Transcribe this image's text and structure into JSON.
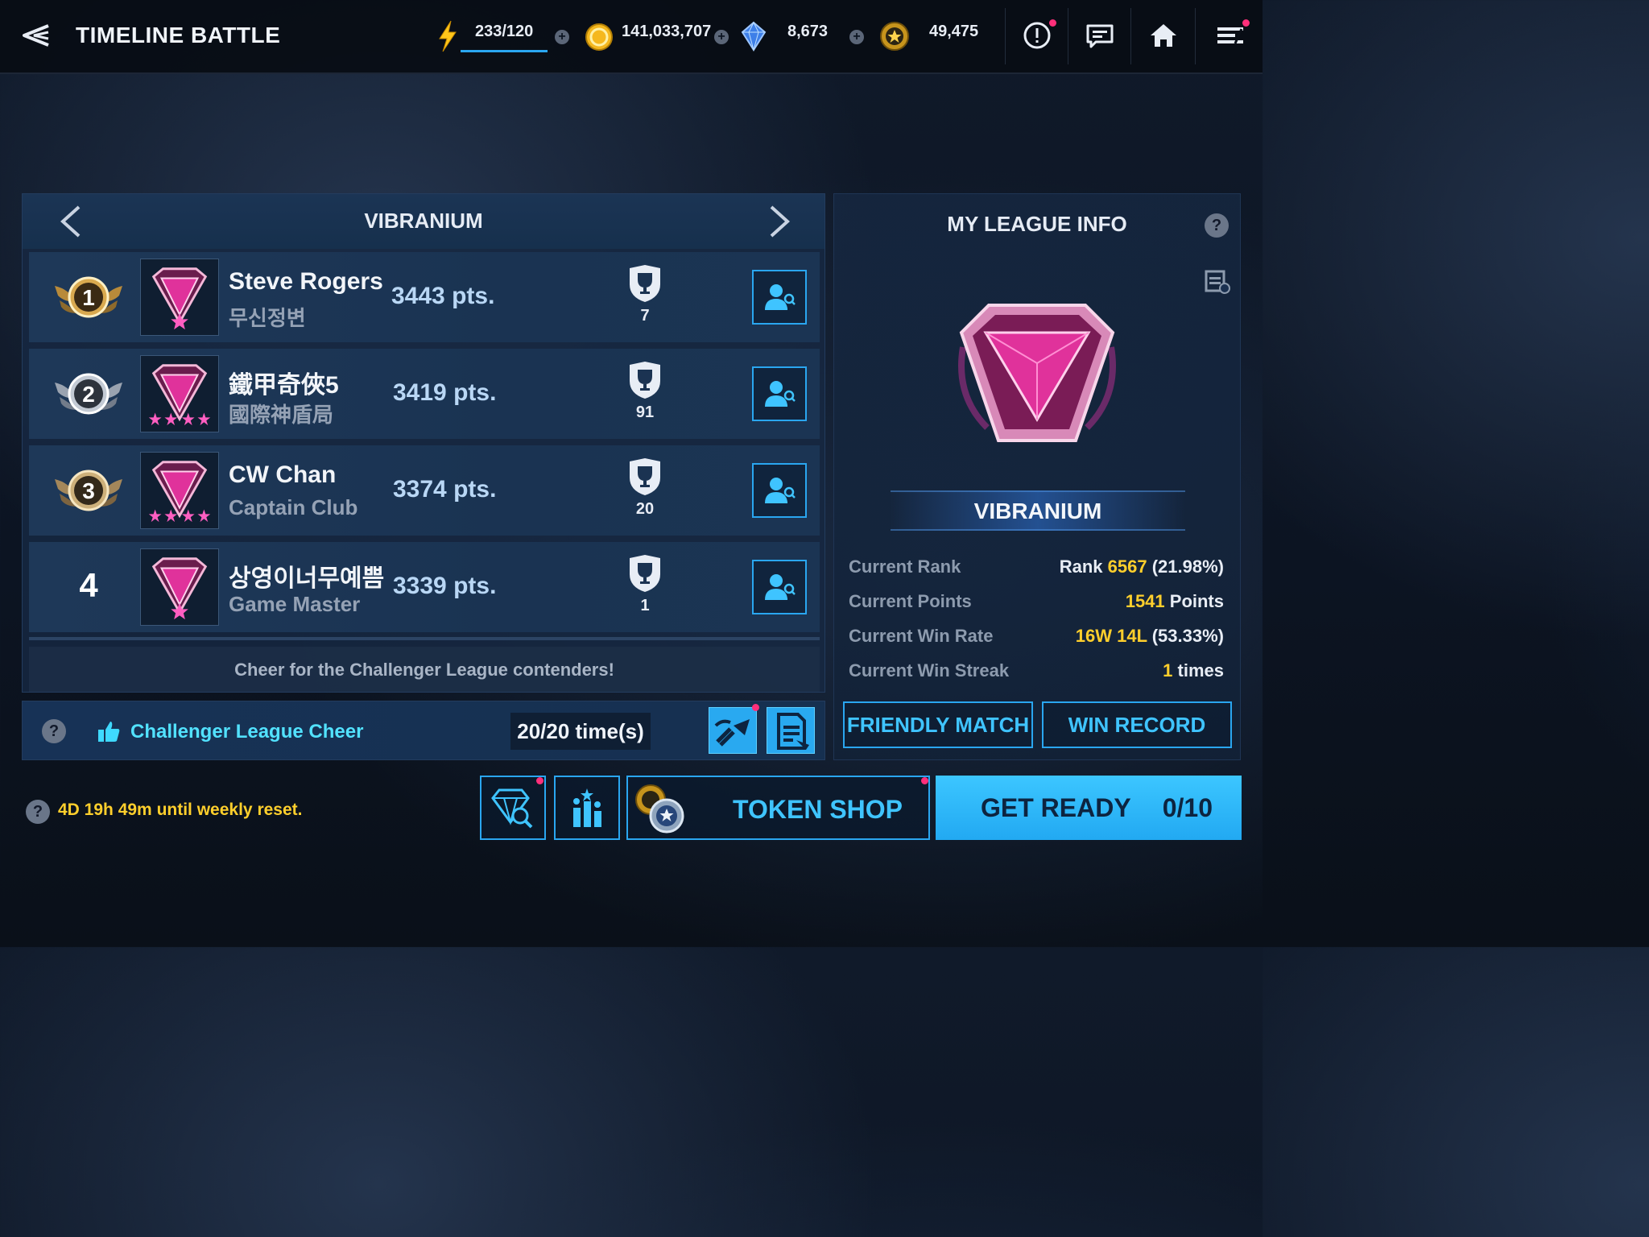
{
  "header": {
    "title": "TIMELINE BATTLE",
    "stamina": "233/120",
    "gold": "141,033,707",
    "crystals": "8,673",
    "tokens": "49,475"
  },
  "league": {
    "tier_title": "VIBRANIUM",
    "players": [
      {
        "rank": "1",
        "name": "Steve Rogers",
        "alliance": "무신정변",
        "points": "3443 pts.",
        "trophies": "7"
      },
      {
        "rank": "2",
        "name": "鐵甲奇俠5",
        "alliance": "國際神盾局",
        "points": "3419 pts.",
        "trophies": "91"
      },
      {
        "rank": "3",
        "name": "CW Chan",
        "alliance": "Captain Club",
        "points": "3374 pts.",
        "trophies": "20"
      },
      {
        "rank": "4",
        "name": "상영이너무예쁨",
        "alliance": "Game Master",
        "points": "3339 pts.",
        "trophies": "1"
      }
    ],
    "cheer_message": "Cheer for the Challenger League contenders!",
    "cheer_label": "Challenger League Cheer",
    "cheer_count": "20/20 time(s)"
  },
  "my_league": {
    "title": "MY LEAGUE INFO",
    "tier": "VIBRANIUM",
    "rank_label": "Current Rank",
    "rank_prefix": "Rank ",
    "rank_value": "6567",
    "rank_pct": " (21.98%)",
    "points_label": "Current Points",
    "points_value": "1541",
    "points_suffix": " Points",
    "winrate_label": "Current Win Rate",
    "winrate_value": "16W 14L",
    "winrate_pct": " (53.33%)",
    "streak_label": "Current Win Streak",
    "streak_value": "1",
    "streak_suffix": " times",
    "friendly_match": "FRIENDLY MATCH",
    "win_record": "WIN RECORD"
  },
  "footer": {
    "reset_time": "4D 19h 49m",
    "reset_suffix": " until weekly reset.",
    "token_shop": "TOKEN SHOP",
    "get_ready": "GET READY",
    "ready_count": "0/10"
  },
  "colors": {
    "accent": "#2aa6f0",
    "highlight": "#ffcf2c",
    "cheer": "#52e2ff",
    "emblem": "#e0329b"
  }
}
